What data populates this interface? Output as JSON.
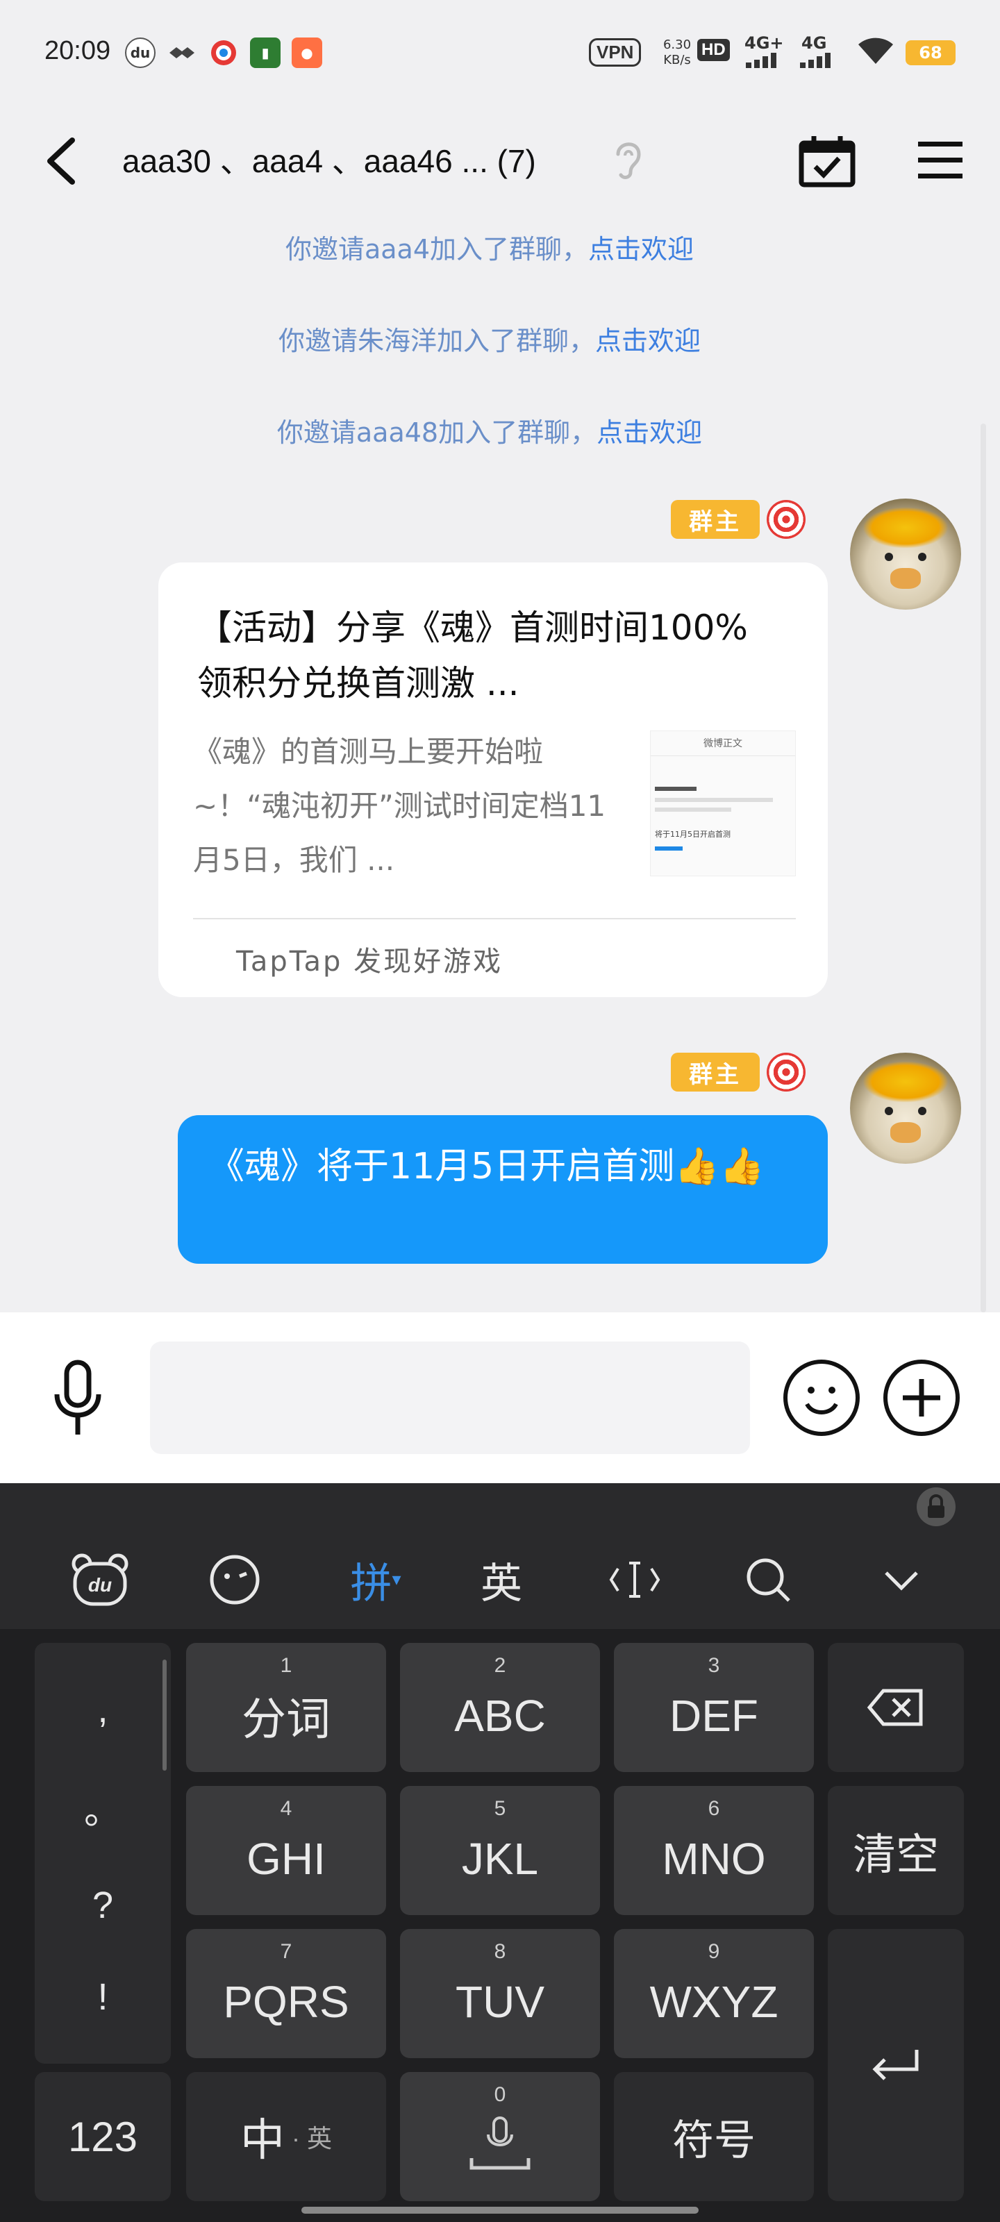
{
  "status_bar": {
    "time": "20:09",
    "vpn": "VPN",
    "speed_value": "6.30",
    "speed_unit": "KB/s",
    "hd": "HD",
    "net1": "4G+",
    "net2": "4G",
    "battery": "68"
  },
  "nav": {
    "title": "aaa30 、aaa4 、aaa46 ... (7)"
  },
  "system_messages": [
    {
      "text": "你邀请aaa4加入了群聊，",
      "link": "点击欢迎"
    },
    {
      "text": "你邀请朱海洋加入了群聊，",
      "link": "点击欢迎"
    },
    {
      "text": "你邀请aaa48加入了群聊，",
      "link": "点击欢迎"
    }
  ],
  "badge_label": "群主",
  "card": {
    "title": "【活动】分享《魂》首测时间100%领积分兑换首测激 ...",
    "description": "《魂》的首测马上要开始啦~！“魂沌初开”测试时间定档11月5日，我们 ...",
    "thumb_header": "微博正文",
    "thumb_text": "将于11月5日开启首测",
    "source": "TapTap 发现好游戏"
  },
  "bubble": {
    "text": "《魂》将于11月5日开启首测👍👍"
  },
  "keyboard": {
    "toolbar": [
      "拼",
      "英"
    ],
    "side_punct": [
      ",",
      "。",
      "?",
      "!"
    ],
    "keys": [
      {
        "num": "1",
        "label": "分词"
      },
      {
        "num": "2",
        "label": "ABC"
      },
      {
        "num": "3",
        "label": "DEF"
      },
      {
        "num": "4",
        "label": "GHI"
      },
      {
        "num": "5",
        "label": "JKL"
      },
      {
        "num": "6",
        "label": "MNO"
      },
      {
        "num": "7",
        "label": "PQRS"
      },
      {
        "num": "8",
        "label": "TUV"
      },
      {
        "num": "9",
        "label": "WXYZ"
      }
    ],
    "clear": "清空",
    "num_key": "123",
    "lang_key": "中",
    "lang_sub": "· 英",
    "space_num": "0",
    "symbol_key": "符号"
  },
  "colors": {
    "bubble": "#1598fa",
    "link": "#3d7fe0",
    "badge": "#f7b731",
    "keyboard_bg": "#1f1f21",
    "pinyin_active": "#3a8ee6"
  }
}
